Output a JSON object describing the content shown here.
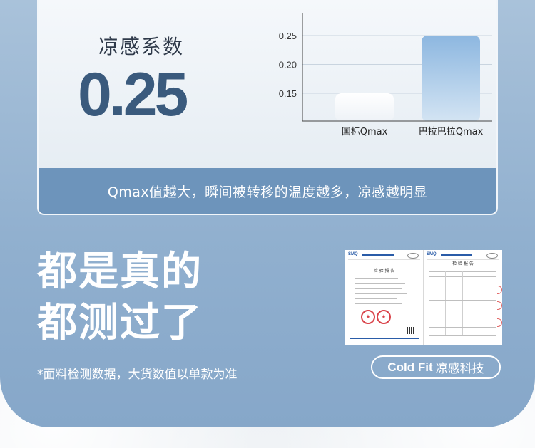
{
  "metric": {
    "label": "凉感系数",
    "value": "0.25"
  },
  "chart_data": {
    "type": "bar",
    "categories": [
      "国标Qmax",
      "巴拉巴拉Qmax"
    ],
    "values": [
      0.15,
      0.25
    ],
    "yticks": [
      "0.15",
      "0.20",
      "0.25"
    ],
    "ylim": [
      0.1,
      0.25
    ],
    "grid": true,
    "colors": [
      "#eef2f7",
      "#8db7e0"
    ],
    "title": "",
    "xlabel": "",
    "ylabel": ""
  },
  "caption": "Qmax值越大，瞬间被转移的温度越多，凉感越明显",
  "headline": {
    "line1": "都是真的",
    "line2": "都测过了"
  },
  "note": "*面料检测数据，大货数值以单款为准",
  "report": {
    "logo_left": "SMQ",
    "logo_right": "SMQ",
    "page1_title": "检 验 报 告",
    "page2_title": "检 验 报 告"
  },
  "badge": {
    "brand": "Cold Fit",
    "text": "凉感科技"
  }
}
